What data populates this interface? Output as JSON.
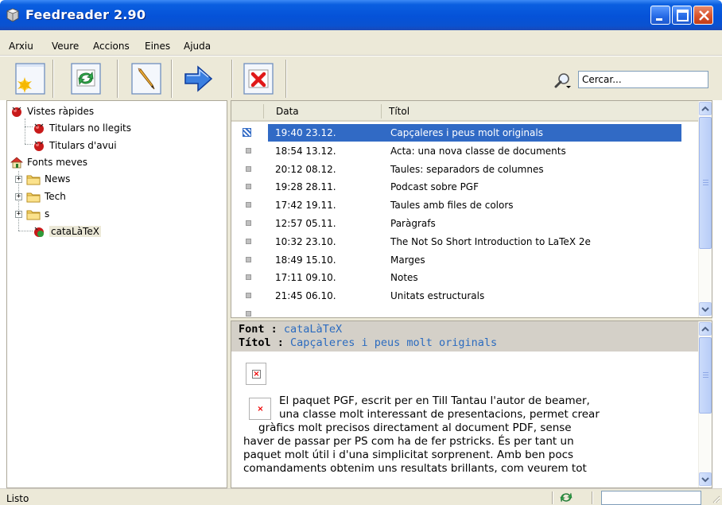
{
  "window": {
    "title": "Feedreader 2.90"
  },
  "menu": [
    "Arxiu",
    "Veure",
    "Accions",
    "Eines",
    "Ajuda"
  ],
  "toolbar": {
    "buttons": [
      "new-feed",
      "refresh",
      "edit",
      "next",
      "delete"
    ],
    "search_placeholder": "Cercar..."
  },
  "tree": {
    "quick_views": "Vistes ràpides",
    "unread": "Titulars no llegits",
    "today": "Titulars d'avui",
    "my_feeds": "Fonts meves",
    "folders": [
      "News",
      "Tech",
      "s"
    ],
    "selected_feed": "cataLàTeX"
  },
  "list": {
    "col_date": "Data",
    "col_title": "Títol",
    "rows": [
      {
        "date": "19:40 23.12.",
        "title": "Capçaleres i peus molt originals"
      },
      {
        "date": "18:54 13.12.",
        "title": "Acta: una nova classe de documents"
      },
      {
        "date": "20:12 08.12.",
        "title": "Taules: separadors de columnes"
      },
      {
        "date": "19:28 28.11.",
        "title": "Podcast sobre PGF"
      },
      {
        "date": "17:42 19.11.",
        "title": "Taules amb files de colors"
      },
      {
        "date": "12:57 05.11.",
        "title": "Paràgrafs"
      },
      {
        "date": "10:32 23.10.",
        "title": "The Not So Short Introduction to LaTeX 2e"
      },
      {
        "date": "18:49 15.10.",
        "title": "Marges"
      },
      {
        "date": "17:11 09.10.",
        "title": "Notes"
      },
      {
        "date": "21:45 06.10.",
        "title": "Unitats estructurals"
      }
    ]
  },
  "preview": {
    "font_label": "Font :",
    "font_value": "cataLàTeX",
    "title_label": "Títol :",
    "title_value": "Capçaleres i peus molt originals",
    "body_lines": [
      "El paquet PGF, escrit per en Till Tantau l'autor de beamer,",
      "una classe molt interessant de presentacions, permet crear",
      "gràfics molt precisos directament al document PDF, sense",
      "haver de passar per PS com ha de fer pstricks. És per tant un",
      "paquet molt útil i d'una simplicitat sorprenent. Amb ben pocs",
      "comandaments obtenim uns resultats brillants, com veurem tot"
    ]
  },
  "status": {
    "text": "Listo"
  },
  "colors": {
    "selection": "#316ac5",
    "link": "#2b6bbf",
    "chrome": "#ece9d8"
  }
}
